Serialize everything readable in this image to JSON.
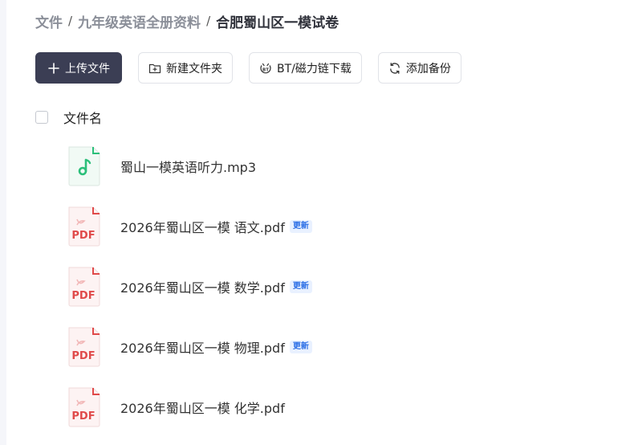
{
  "breadcrumb": {
    "items": [
      "文件",
      "九年级英语全册资料",
      "合肥蜀山区一模试卷"
    ],
    "separator": "/"
  },
  "toolbar": {
    "upload": "上传文件",
    "new_folder": "新建文件夹",
    "bt_download": "BT/磁力链下载",
    "add_backup": "添加备份"
  },
  "table": {
    "column_name": "文件名"
  },
  "files": [
    {
      "name": "蜀山一模英语听力.mp3",
      "type": "audio",
      "icon": "music-note-icon",
      "badge": ""
    },
    {
      "name": "2026年蜀山区一模 语文.pdf",
      "type": "pdf",
      "icon": "pdf-icon",
      "icon_label": "PDF",
      "badge": "更新"
    },
    {
      "name": "2026年蜀山区一模 数学.pdf",
      "type": "pdf",
      "icon": "pdf-icon",
      "icon_label": "PDF",
      "badge": "更新"
    },
    {
      "name": "2026年蜀山区一模 物理.pdf",
      "type": "pdf",
      "icon": "pdf-icon",
      "icon_label": "PDF",
      "badge": "更新"
    },
    {
      "name": "2026年蜀山区一模 化学.pdf",
      "type": "pdf",
      "icon": "pdf-icon",
      "icon_label": "PDF",
      "badge": ""
    }
  ],
  "colors": {
    "primary_button": "#3b3e54",
    "audio_icon": "#2bbf7a",
    "pdf_icon": "#e04a4a",
    "badge_text": "#2c6fe6",
    "badge_bg": "#e9f1ff"
  }
}
